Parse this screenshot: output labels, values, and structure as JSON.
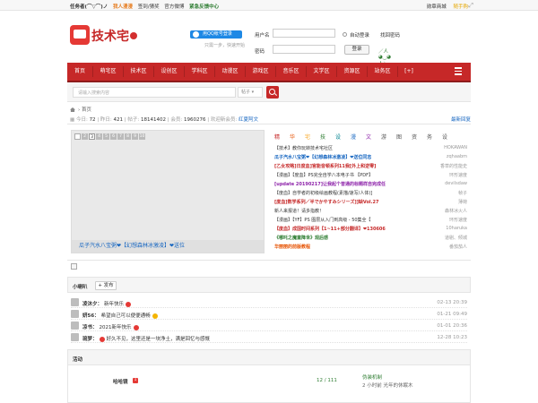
{
  "topbar": {
    "user": "任务者(⌒▽⌒)ノ",
    "my_hero": "我人漫漫",
    "checkin": "签到/猜奖",
    "official_weibo": "官方微博",
    "feedback": "紧急反馈中心",
    "shop": "勋章商城",
    "lottery": "随手购",
    "expand_icon": "expand-icon"
  },
  "header": {
    "logo_text": "技术宅",
    "qq_login": "用QQ帐号登录",
    "qq_sub": "只需一步，快速开始",
    "username_label": "用户名",
    "username_placeholder": "",
    "password_label": "密码",
    "auto_login": "自动登录",
    "find_password": "找回密码",
    "login_button": "登录",
    "social_links": "／人◕‿◕人＼打下契约（注册新用户）"
  },
  "nav": {
    "items": [
      "首页",
      "萌宅区",
      "技术区",
      "设创区",
      "学科区",
      "动漫区",
      "游戏区",
      "音乐区",
      "文学区",
      "资源区",
      "站务区",
      "[+]"
    ],
    "menu_icon": "menu-icon"
  },
  "search": {
    "placeholder": "请输入搜索内容",
    "select": "帖子",
    "button_icon": "search-icon"
  },
  "breadcrumb": {
    "home_icon": "home-icon",
    "current": "首页"
  },
  "stats": {
    "today_label": "今日:",
    "today": "72",
    "yesterday_label": "昨日:",
    "yesterday": "421",
    "posts_label": "帖子:",
    "posts": "18141402",
    "members_label": "会员:",
    "members": "1960276",
    "newest_label": "欢迎新会员:",
    "newest": "红夏阿文",
    "latest_replies": "最新回复"
  },
  "slide": {
    "numbers": [
      "1",
      "2",
      "3",
      "4",
      "5",
      "6",
      "7",
      "8",
      "9",
      "10"
    ],
    "active": "3",
    "caption": "瓜子汽水八宝粥❤【幻想森林冰激凌】❤送位"
  },
  "tabs": [
    "精",
    "华",
    "宅",
    "技",
    "设",
    "漫",
    "文",
    "游",
    "图",
    "资",
    "务",
    "设"
  ],
  "tab_colors": [
    "#c62828",
    "#e65100",
    "#f9a825",
    "#2e7d32",
    "#00838f",
    "#1565c0",
    "#8e24aa",
    "#555555",
    "#555555",
    "#555555",
    "#555555",
    "#555555"
  ],
  "threads": [
    {
      "title": "【技术】教你玩转技术宅社区",
      "author": "HOKAWAN",
      "style": "c-plain"
    },
    {
      "title": "瓜子汽水八宝粥❤【幻想森林冰激凌】❤送位同志",
      "author": "zqhaabm",
      "style": "c-blue"
    },
    {
      "title": "[乙女攻略]日度血]官能音顿系列11我[外上和逆零]",
      "author": "香草的性能史",
      "style": "c-red"
    },
    {
      "title": "【漫画】【度血】PS完全自学八本电子书 【PDF】",
      "author": "环形速度",
      "style": "c-plain"
    },
    {
      "title": "[update 20190217]让我起个普通的标题样自完成任",
      "author": "devilsdaw",
      "style": "c-purple"
    },
    {
      "title": "【度血】自学者的初级绘画教程(素描/速写/人体)]",
      "author": "帧子",
      "style": "c-plain"
    },
    {
      "title": "[度血]数学系列／半でかやすみシリーズ]]缺Vol.27",
      "author": "薄荷",
      "style": "c-red"
    },
    {
      "title": "新人来报道！请多指教！",
      "author": "森林冰火人",
      "style": "c-plain"
    },
    {
      "title": "【漫画】【YF】PS 图层从入门到高级 - 50集全【",
      "author": "环形速度",
      "style": "c-plain"
    },
    {
      "title": "【度血】成国时间系列【1~11+部分翻译】❤130606",
      "author": "10haruka",
      "style": "c-red"
    },
    {
      "title": "《哪吒之魔童降世》观后感",
      "author": "道剔、倾城",
      "style": "c-green"
    },
    {
      "title": "华丽丽的前版教程",
      "author": "番茄茄人",
      "style": "c-orange"
    }
  ],
  "doing": {
    "title": "小喇叭",
    "post_button": "+ 发布",
    "items": [
      {
        "user": "凌沐夕：",
        "text": "新年快乐",
        "time": "02-13 20:39",
        "emoji": "red"
      },
      {
        "user": "妍56：",
        "text": "希望自己可以便便通畅",
        "time": "01-21 09:49",
        "emoji": "yellow"
      },
      {
        "user": "凉书：",
        "text": "2021新年快乐",
        "time": "01-01 20:36",
        "emoji": "red"
      },
      {
        "user": "琉梦：",
        "text": "好久不见，这里还是一块净土，满是回忆与感慨",
        "time": "12-28 10:23",
        "emoji": "red"
      }
    ]
  },
  "activity": {
    "title": "活动",
    "name": "哈哈镜",
    "badge": "1",
    "count": "12 / 111",
    "event_title": "伪装机制",
    "event_time": "2 小时前 光年的休眠木"
  }
}
